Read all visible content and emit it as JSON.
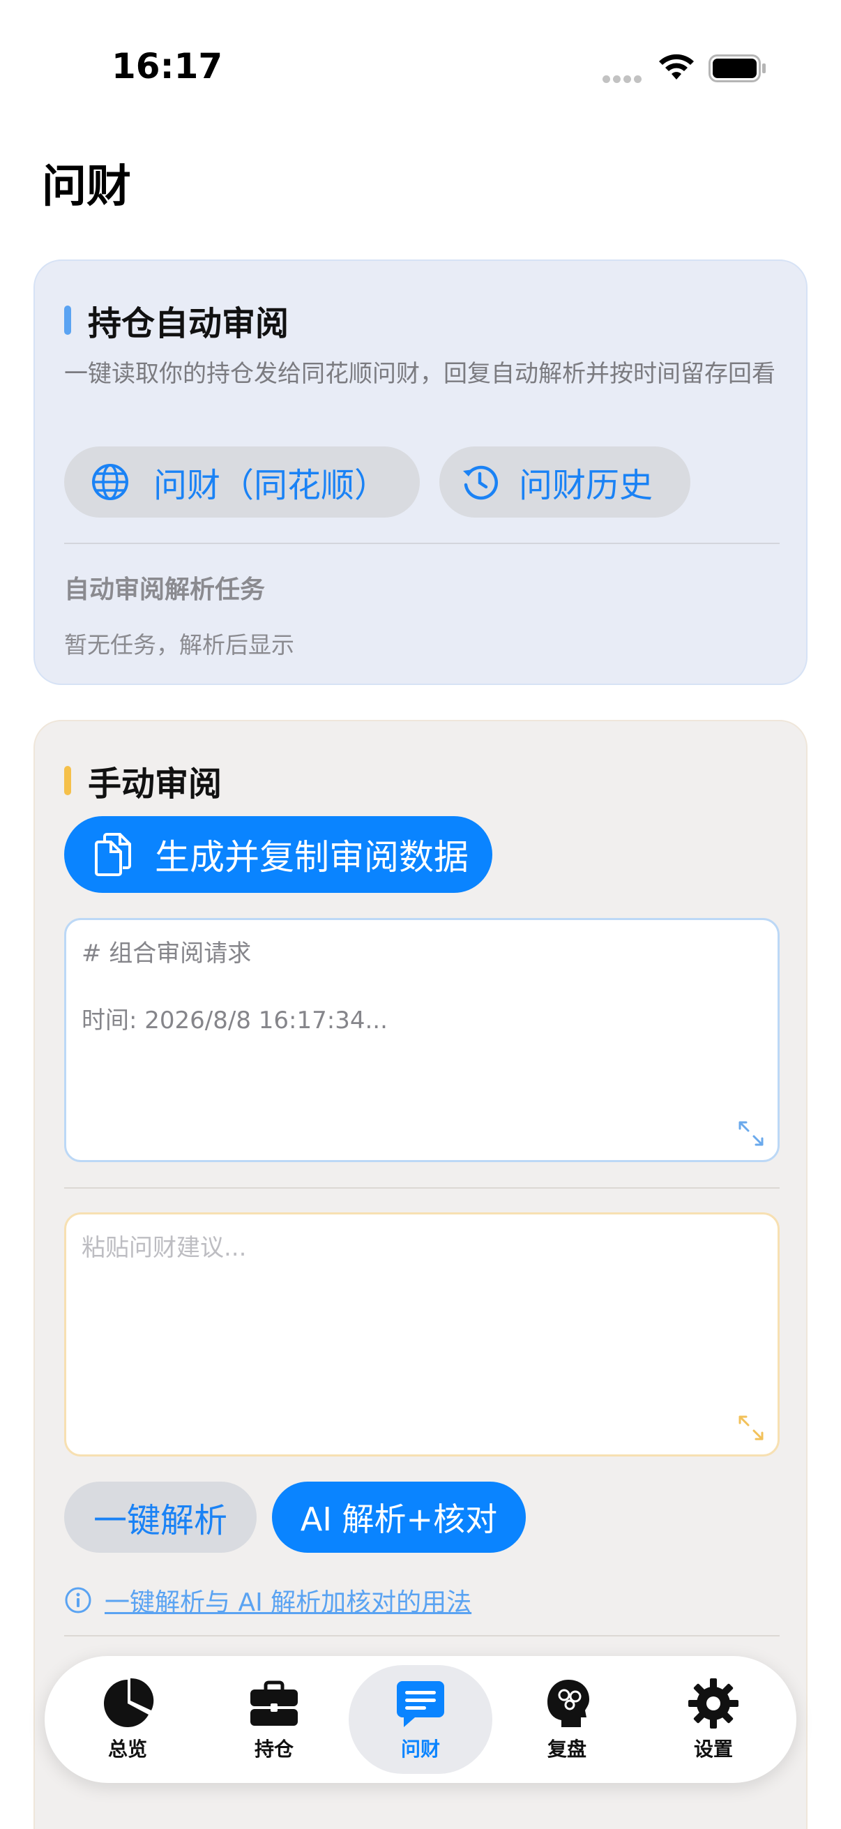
{
  "status_bar": {
    "time": "16:17"
  },
  "page": {
    "title": "问财"
  },
  "auto_review": {
    "title": "持仓自动审阅",
    "description": "一键读取你的持仓发给同花顺问财，回复自动解析并按时间留存回看",
    "wencai_button_label": "问财（同花顺）",
    "history_button_label": "问财历史",
    "tasks_title": "自动审阅解析任务",
    "tasks_empty": "暂无任务，解析后显示"
  },
  "manual_review": {
    "title": "手动审阅",
    "generate_button_label": "生成并复制审阅数据",
    "request_line1": "# 组合审阅请求",
    "request_line2": "时间: 2026/8/8 16:17:34...",
    "paste_placeholder": "粘贴问财建议...",
    "parse_button_label": "一键解析",
    "ai_parse_button_label": "AI 解析+核对",
    "usage_link": "一键解析与 AI 解析加核对的用法"
  },
  "tab_bar": {
    "tabs": [
      {
        "label": "总览",
        "icon": "pie-chart-icon"
      },
      {
        "label": "持仓",
        "icon": "briefcase-icon"
      },
      {
        "label": "问财",
        "icon": "chat-icon",
        "active": true
      },
      {
        "label": "复盘",
        "icon": "brain-head-icon"
      },
      {
        "label": "设置",
        "icon": "gear-icon"
      }
    ]
  },
  "colors": {
    "accent": "#0a84ff",
    "auto_card_bg": "#e8ecf6",
    "manual_card_bg": "#f1efee",
    "blue_accent_bar": "#5aa3f2",
    "yellow_accent_bar": "#f5c04a"
  }
}
